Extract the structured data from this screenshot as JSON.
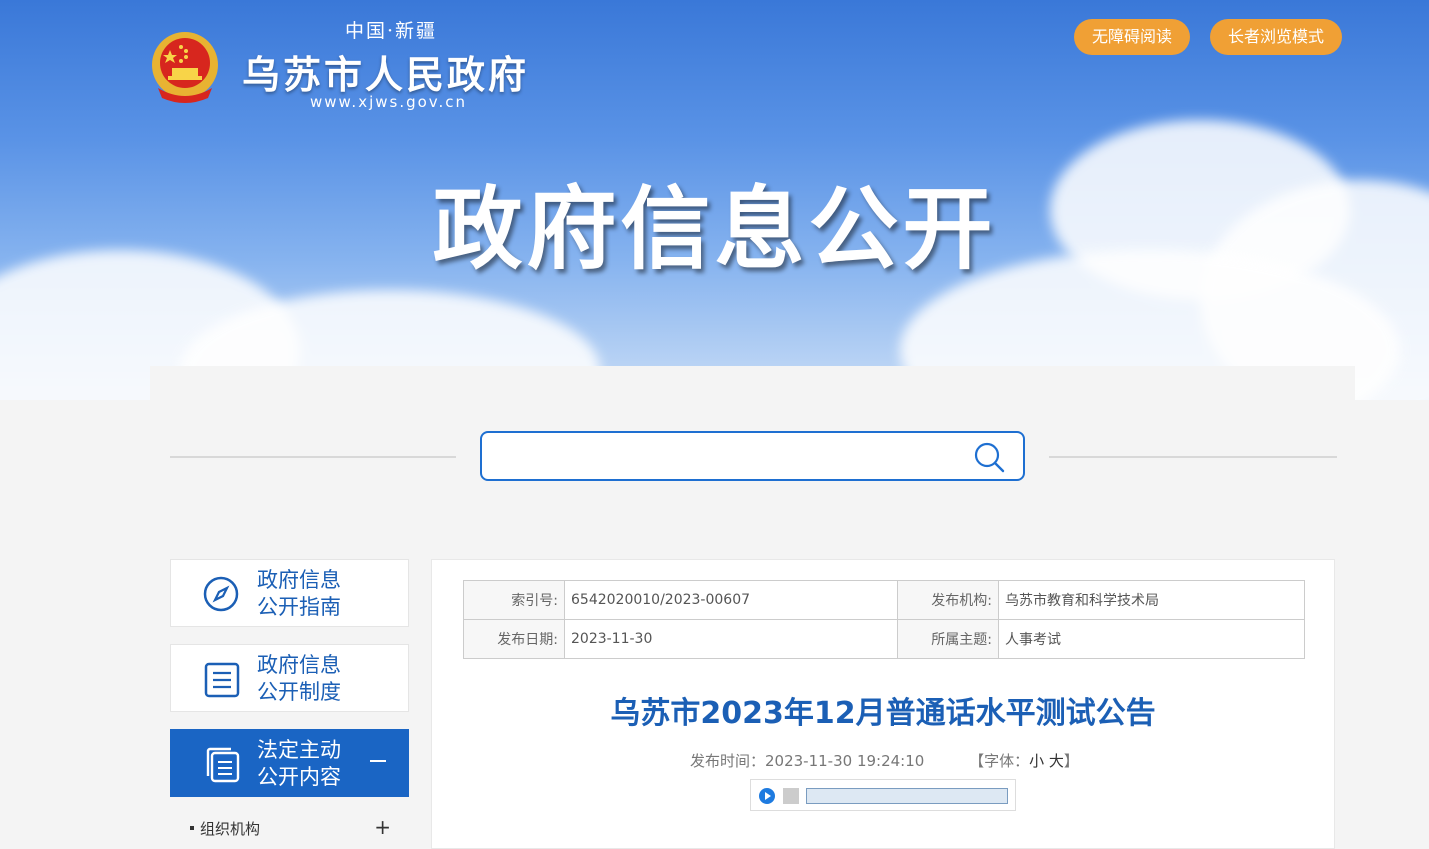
{
  "header": {
    "region": "中国·新疆",
    "site_title": "乌苏市人民政府",
    "site_url": "www.xjws.gov.cn",
    "buttons": {
      "accessibility": "无障碍阅读",
      "elderly_mode": "长者浏览模式"
    },
    "banner_title": "政府信息公开"
  },
  "search": {
    "placeholder": ""
  },
  "sidebar": {
    "items": [
      {
        "label": "政府信息\n公开指南",
        "icon": "compass-icon"
      },
      {
        "label": "政府信息\n公开制度",
        "icon": "document-list-icon"
      },
      {
        "label": "法定主动\n公开内容",
        "icon": "documents-icon",
        "active": true
      }
    ],
    "sub_items": [
      {
        "label": "组织机构"
      }
    ]
  },
  "meta": {
    "index_label": "索引号:",
    "index_value": "6542020010/2023-00607",
    "org_label": "发布机构:",
    "org_value": "乌苏市教育和科学技术局",
    "date_label": "发布日期:",
    "date_value": "2023-11-30",
    "topic_label": "所属主题:",
    "topic_value": "人事考试"
  },
  "article": {
    "title": "乌苏市2023年12月普通话水平测试公告",
    "publish_time": "发布时间：2023-11-30 19:24:10",
    "font_label_open": "【字体：",
    "font_small": "小",
    "font_large": "大",
    "font_label_close": "】"
  },
  "colors": {
    "brand_blue": "#1b5fb5",
    "accent_orange": "#f0a035",
    "active_blue": "#1a65c4"
  }
}
